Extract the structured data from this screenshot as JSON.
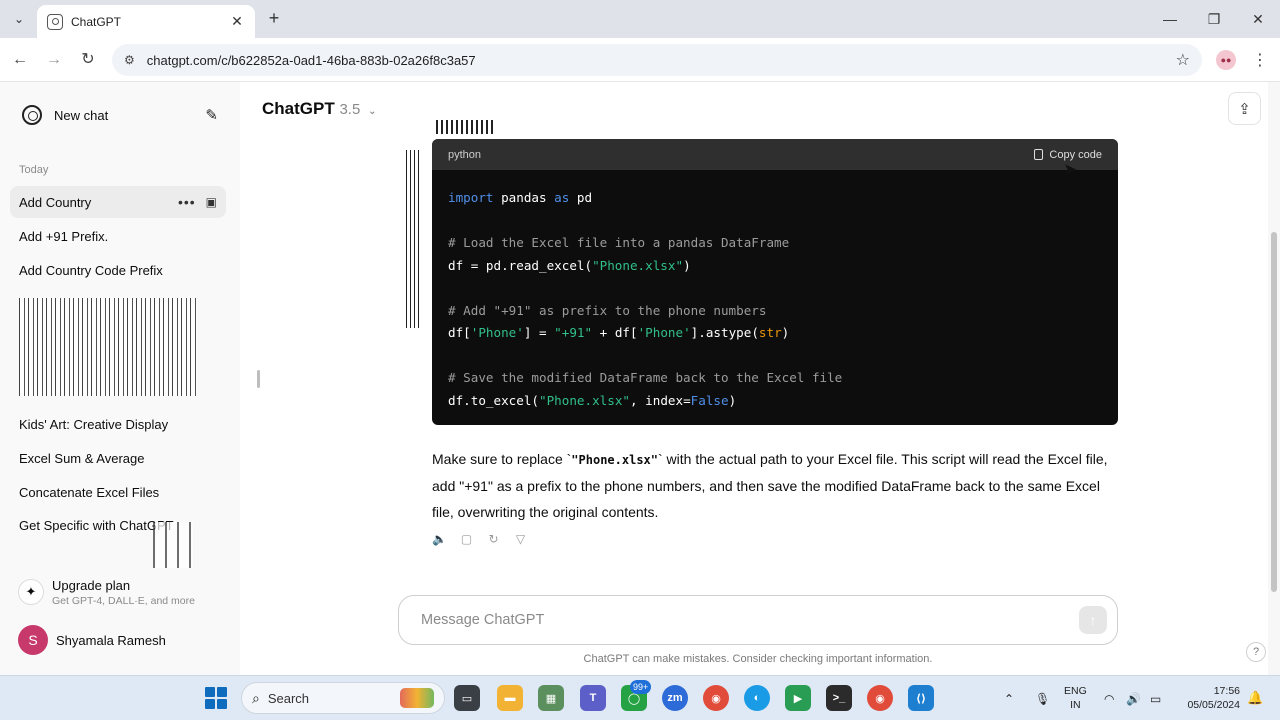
{
  "browser": {
    "tab_title": "ChatGPT",
    "url": "chatgpt.com/c/b622852a-0ad1-46ba-883b-02a26f8c3a57"
  },
  "sidebar": {
    "new_chat": "New chat",
    "section_today": "Today",
    "items": [
      {
        "label": "Add Country"
      },
      {
        "label": "Add +91 Prefix."
      },
      {
        "label": "Add Country Code Prefix"
      },
      {
        "label": "Kids' Art: Creative Display"
      },
      {
        "label": "Excel Sum & Average"
      },
      {
        "label": "Concatenate Excel Files"
      },
      {
        "label": "Get Specific with ChatGPT"
      }
    ],
    "upgrade_title": "Upgrade plan",
    "upgrade_sub": "Get GPT-4, DALL·E, and more",
    "user_initial": "S",
    "user_name": "Shyamala Ramesh"
  },
  "header": {
    "model": "ChatGPT",
    "version": "3.5"
  },
  "code_block": {
    "language": "python",
    "copy_label": "Copy code"
  },
  "answer": {
    "part1": "Make sure to replace `",
    "code": "\"Phone.xlsx\"",
    "part2": "` with the actual path to your Excel file. This script will read the Excel file, add \"+91\" as a prefix to the phone numbers, and then save the modified DataFrame back to the same Excel file, overwriting the original contents."
  },
  "composer": {
    "placeholder": "Message ChatGPT",
    "disclaimer": "ChatGPT can make mistakes. Consider checking important information."
  },
  "taskbar": {
    "search_placeholder": "Search",
    "badge_count": "99+",
    "lang_1": "ENG",
    "lang_2": "IN",
    "time": "17:56",
    "date": "05/05/2024"
  },
  "colors": {
    "keyword": "#4f8fe8",
    "comment": "#9b9b9b",
    "string": "#31bf8a",
    "builtin": "#e9950c",
    "accent": "#0f6cbd"
  }
}
